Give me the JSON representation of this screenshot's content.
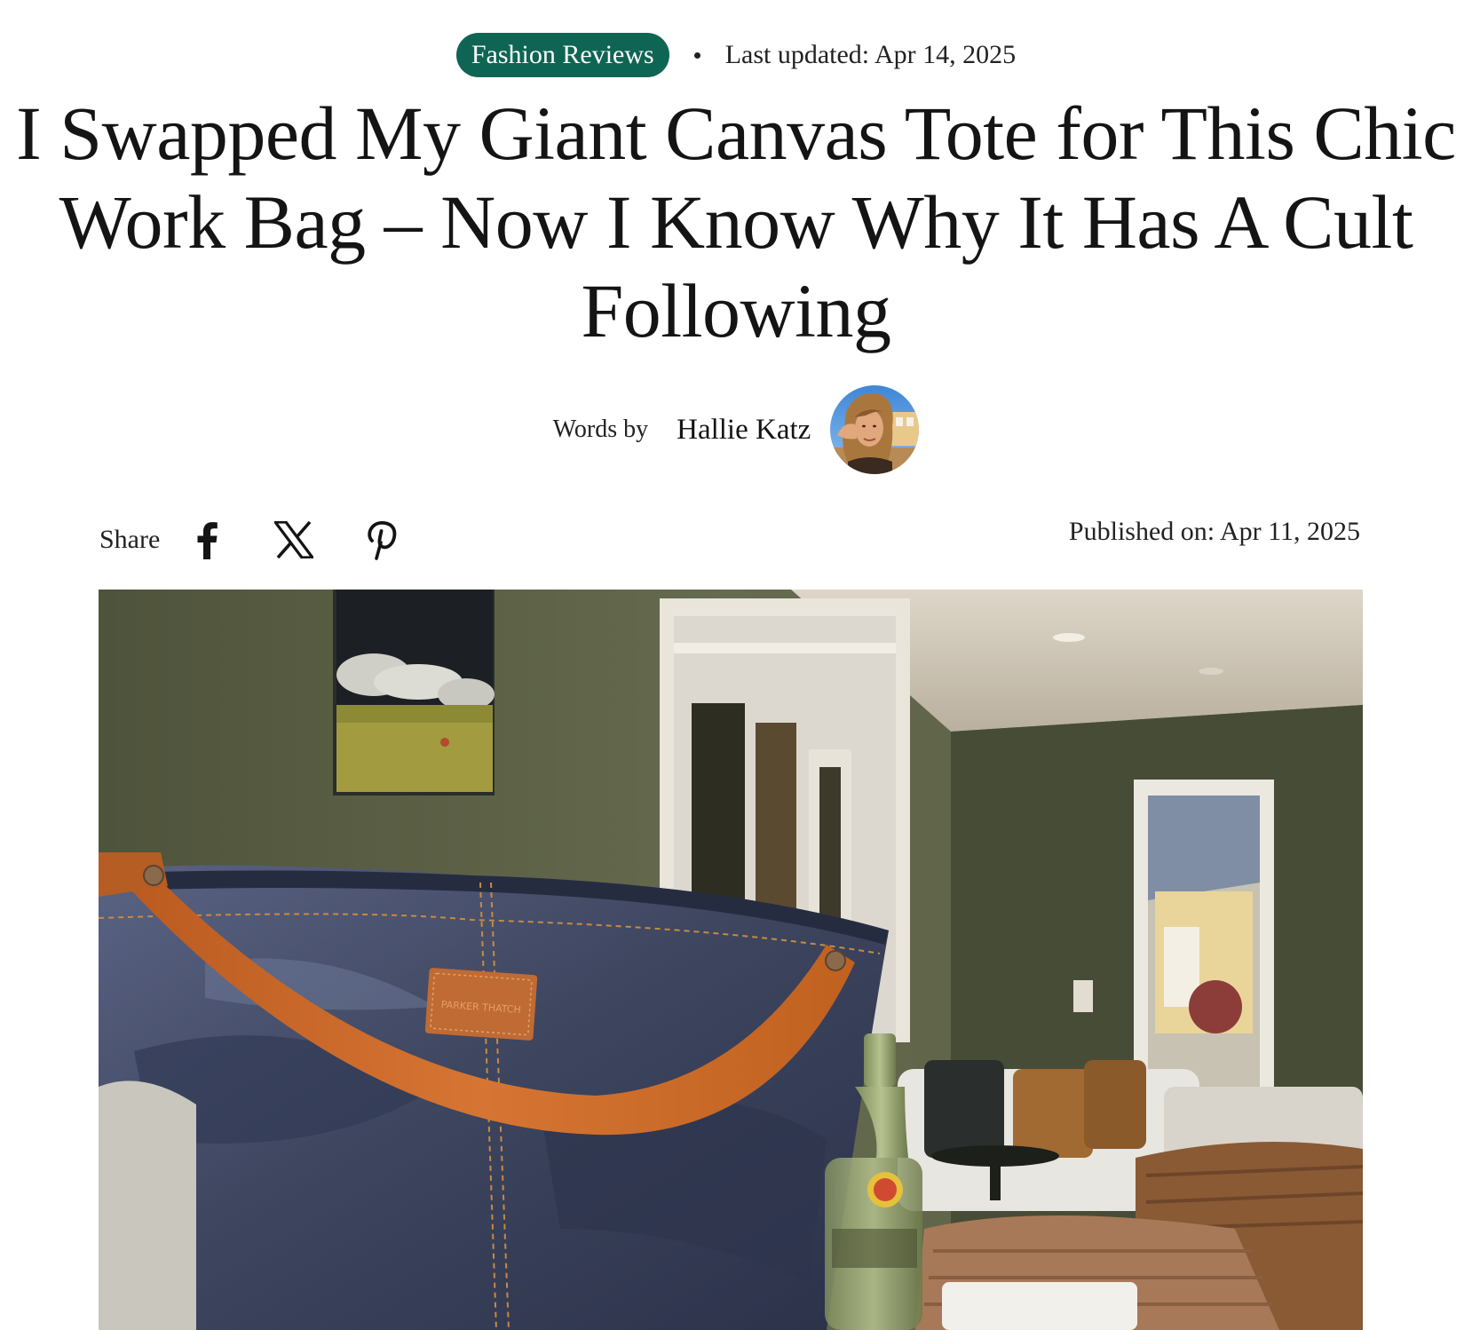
{
  "meta": {
    "category": "Fashion Reviews",
    "last_updated": "Last updated: Apr 14, 2025"
  },
  "headline": "I Swapped My Giant Canvas Tote for This Chic Work Bag – Now I Know Why It Has A Cult Following",
  "byline": {
    "prefix": "Words by",
    "author": "Hallie Katz"
  },
  "share": {
    "label": "Share",
    "icons": [
      "facebook-icon",
      "x-icon",
      "pinterest-icon"
    ]
  },
  "published": "Published on: Apr 11, 2025",
  "hero": {
    "bag_label": "PARKER THATCH",
    "description": "Denim tote bag with orange leather strap"
  },
  "colors": {
    "accent": "#0f6553",
    "text": "#141414",
    "strap": "#c8682a",
    "denim": "#3e4660",
    "wall": "#5d6148"
  }
}
